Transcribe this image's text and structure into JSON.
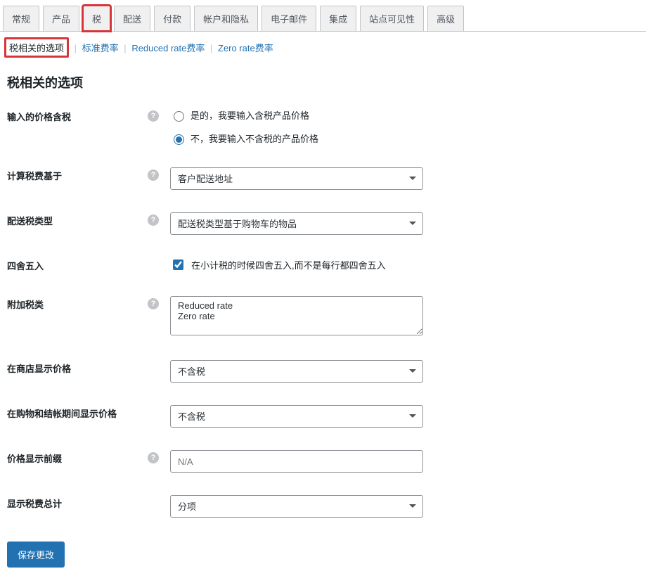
{
  "tabs": [
    "常规",
    "产品",
    "税",
    "配送",
    "付款",
    "帐户和隐私",
    "电子邮件",
    "集成",
    "站点可见性",
    "高级"
  ],
  "activeTab": "税",
  "subsub": {
    "current": "税相关的选项",
    "items": [
      "税相关的选项",
      "标准费率",
      "Reduced rate费率",
      "Zero rate费率"
    ]
  },
  "sectionTitle": "税相关的选项",
  "fields": {
    "prices_include_tax": {
      "label": "输入的价格含税",
      "option_yes": "是的，我要输入含税产品价格",
      "option_no": "不，我要输入不含税的产品价格",
      "value": "no"
    },
    "tax_based_on": {
      "label": "计算税费基于",
      "value": "客户配送地址"
    },
    "shipping_tax_class": {
      "label": "配送税类型",
      "value": "配送税类型基于购物车的物品"
    },
    "rounding": {
      "label": "四舍五入",
      "desc": "在小计税的时候四舍五入,而不是每行都四舍五入",
      "checked": true
    },
    "additional_tax": {
      "label": "附加税类",
      "value": "Reduced rate\nZero rate"
    },
    "display_shop": {
      "label": "在商店显示价格",
      "value": "不含税"
    },
    "display_cart": {
      "label": "在购物和结帐期间显示价格",
      "value": "不含税"
    },
    "price_suffix": {
      "label": "价格显示前缀",
      "placeholder": "N/A",
      "value": ""
    },
    "tax_total_display": {
      "label": "显示税费总计",
      "value": "分项"
    }
  },
  "saveLabel": "保存更改",
  "helpGlyph": "?"
}
